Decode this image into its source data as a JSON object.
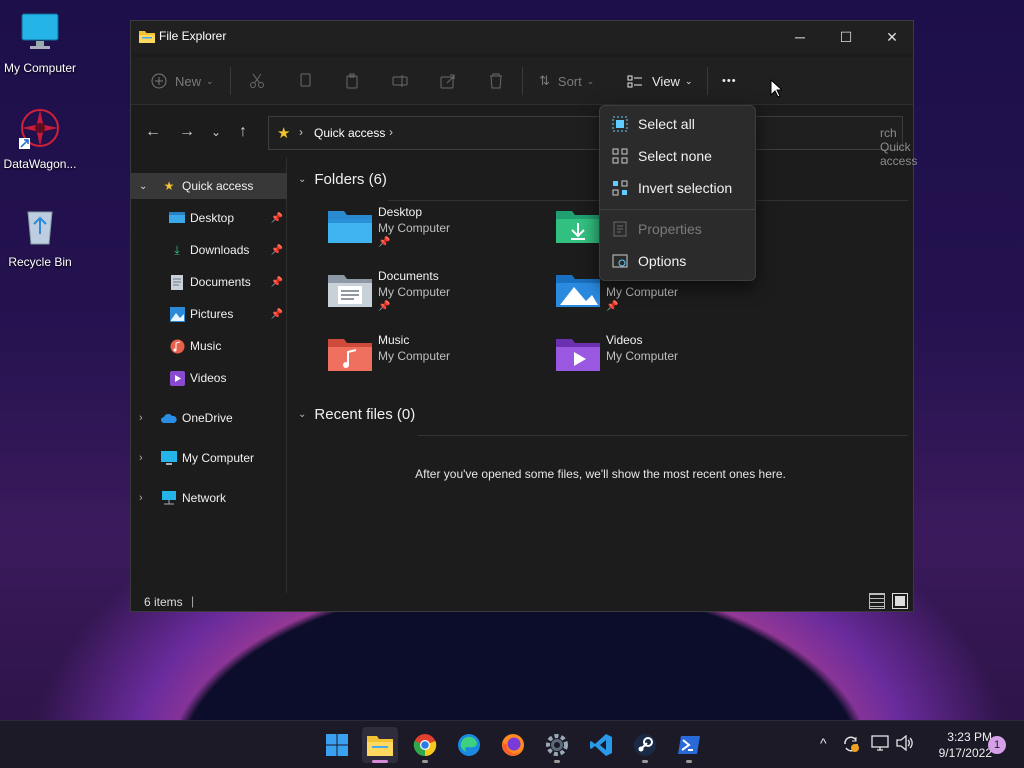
{
  "desktop": {
    "icons": [
      {
        "label": "My Computer"
      },
      {
        "label": "DataWagon..."
      },
      {
        "label": "Recycle Bin"
      }
    ]
  },
  "window": {
    "title": "File Explorer",
    "controls": {
      "minimize": "─",
      "maximize": "☐",
      "close": "✕"
    }
  },
  "toolbar": {
    "new_label": "New",
    "sort_label": "Sort",
    "view_label": "View",
    "more_label": "•••"
  },
  "address": {
    "crumb": "Quick access",
    "search_placeholder": "Search Quick access",
    "search_visible_text": "rch Quick access"
  },
  "sidebar": {
    "items": [
      {
        "label": "Quick access",
        "icon": "star-icon"
      },
      {
        "label": "Desktop",
        "icon": "desktop-folder-icon"
      },
      {
        "label": "Downloads",
        "icon": "download-icon"
      },
      {
        "label": "Documents",
        "icon": "documents-icon"
      },
      {
        "label": "Pictures",
        "icon": "pictures-icon"
      },
      {
        "label": "Music",
        "icon": "music-icon"
      },
      {
        "label": "Videos",
        "icon": "videos-icon"
      },
      {
        "label": "OneDrive",
        "icon": "onedrive-icon"
      },
      {
        "label": "My Computer",
        "icon": "computer-icon"
      },
      {
        "label": "Network",
        "icon": "network-icon"
      }
    ]
  },
  "main": {
    "folders_header": "Folders (6)",
    "recent_header": "Recent files (0)",
    "recent_empty": "After you've opened some files, we'll show the most recent ones here.",
    "folders": [
      {
        "name": "Desktop",
        "location": "My Computer"
      },
      {
        "name": "",
        "location": ""
      },
      {
        "name": "Documents",
        "location": "My Computer"
      },
      {
        "name": "",
        "location": "My Computer"
      },
      {
        "name": "Music",
        "location": "My Computer"
      },
      {
        "name": "Videos",
        "location": "My Computer"
      }
    ]
  },
  "status": {
    "items": "6 items"
  },
  "menu": {
    "items": [
      {
        "label": "Select all"
      },
      {
        "label": "Select none"
      },
      {
        "label": "Invert selection"
      },
      {
        "label": "Properties"
      },
      {
        "label": "Options"
      }
    ]
  },
  "taskbar": {
    "apps": [
      "windows-start",
      "file-explorer",
      "chrome",
      "edge",
      "firefox",
      "settings",
      "vscode",
      "steam",
      "powershell"
    ],
    "clock_time": "3:23 PM",
    "clock_date": "9/17/2022",
    "notification_count": "1",
    "tray_chevron": "^"
  },
  "colors": {
    "accent": "#60cdff",
    "folder_yellow": "#f3c233"
  }
}
